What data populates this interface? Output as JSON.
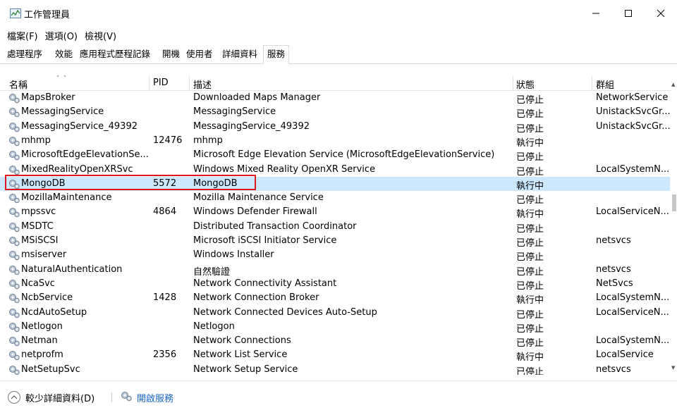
{
  "window": {
    "title": "工作管理員"
  },
  "menu": [
    {
      "label": "檔案(F)"
    },
    {
      "label": "選項(O)"
    },
    {
      "label": "檢視(V)"
    }
  ],
  "tabs": [
    {
      "label": "處理程序",
      "active": false
    },
    {
      "label": "效能",
      "active": false
    },
    {
      "label": "應用程式歷程記錄",
      "active": false
    },
    {
      "label": "開機",
      "active": false
    },
    {
      "label": "使用者",
      "active": false
    },
    {
      "label": "詳細資料",
      "active": false
    },
    {
      "label": "服務",
      "active": true
    }
  ],
  "columns": {
    "name": "名稱",
    "pid": "PID",
    "desc": "描述",
    "status": "狀態",
    "group": "群組"
  },
  "rows": [
    {
      "name": "MapsBroker",
      "pid": "",
      "desc": "Downloaded Maps Manager",
      "status": "已停止",
      "group": "NetworkService"
    },
    {
      "name": "MessagingService",
      "pid": "",
      "desc": "MessagingService",
      "status": "已停止",
      "group": "UnistackSvcGr..."
    },
    {
      "name": "MessagingService_49392",
      "pid": "",
      "desc": "MessagingService_49392",
      "status": "已停止",
      "group": "UnistackSvcGr..."
    },
    {
      "name": "mhmp",
      "pid": "12476",
      "desc": "mhmp",
      "status": "執行中",
      "group": ""
    },
    {
      "name": "MicrosoftEdgeElevationSe...",
      "pid": "",
      "desc": "Microsoft Edge Elevation Service (MicrosoftEdgeElevationService)",
      "status": "已停止",
      "group": ""
    },
    {
      "name": "MixedRealityOpenXRSvc",
      "pid": "",
      "desc": "Windows Mixed Reality OpenXR Service",
      "status": "已停止",
      "group": "LocalSystemN..."
    },
    {
      "name": "MongoDB",
      "pid": "5572",
      "desc": "MongoDB",
      "status": "執行中",
      "group": "",
      "selected": true
    },
    {
      "name": "MozillaMaintenance",
      "pid": "",
      "desc": "Mozilla Maintenance Service",
      "status": "已停止",
      "group": ""
    },
    {
      "name": "mpssvc",
      "pid": "4864",
      "desc": "Windows Defender Firewall",
      "status": "執行中",
      "group": "LocalServiceN..."
    },
    {
      "name": "MSDTC",
      "pid": "",
      "desc": "Distributed Transaction Coordinator",
      "status": "已停止",
      "group": ""
    },
    {
      "name": "MSiSCSI",
      "pid": "",
      "desc": "Microsoft iSCSI Initiator Service",
      "status": "已停止",
      "group": "netsvcs"
    },
    {
      "name": "msiserver",
      "pid": "",
      "desc": "Windows Installer",
      "status": "已停止",
      "group": ""
    },
    {
      "name": "NaturalAuthentication",
      "pid": "",
      "desc": "自然驗證",
      "status": "已停止",
      "group": "netsvcs"
    },
    {
      "name": "NcaSvc",
      "pid": "",
      "desc": "Network Connectivity Assistant",
      "status": "已停止",
      "group": "NetSvcs"
    },
    {
      "name": "NcbService",
      "pid": "1428",
      "desc": "Network Connection Broker",
      "status": "執行中",
      "group": "LocalSystemN..."
    },
    {
      "name": "NcdAutoSetup",
      "pid": "",
      "desc": "Network Connected Devices Auto-Setup",
      "status": "已停止",
      "group": "LocalServiceN..."
    },
    {
      "name": "Netlogon",
      "pid": "",
      "desc": "Netlogon",
      "status": "已停止",
      "group": ""
    },
    {
      "name": "Netman",
      "pid": "",
      "desc": "Network Connections",
      "status": "已停止",
      "group": "LocalSystemN..."
    },
    {
      "name": "netprofm",
      "pid": "2356",
      "desc": "Network List Service",
      "status": "執行中",
      "group": "LocalService"
    },
    {
      "name": "NetSetupSvc",
      "pid": "",
      "desc": "Network Setup Service",
      "status": "已停止",
      "group": "netsvcs"
    }
  ],
  "footer": {
    "less_details": "較少詳細資料(D)",
    "open_services": "開啟服務"
  },
  "colors": {
    "selected_row": "#cce8ff",
    "highlight": "#e0161e",
    "link": "#1a66c2"
  }
}
